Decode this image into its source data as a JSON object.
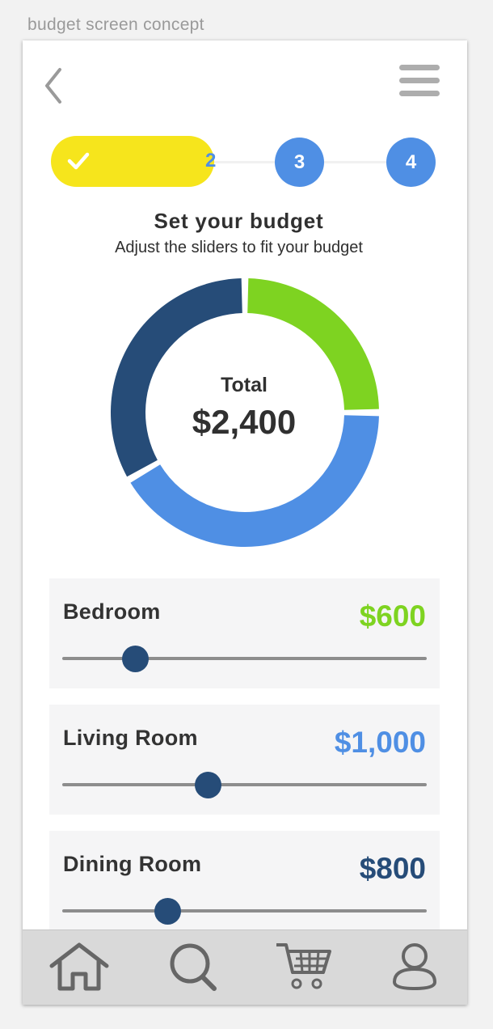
{
  "caption": "budget screen concept",
  "header": {
    "back_icon": "chevron-left-icon",
    "menu_icon": "hamburger-menu-icon"
  },
  "stepper": {
    "completed_icon": "check-icon",
    "current_step": "2",
    "steps": [
      "3",
      "4"
    ]
  },
  "page": {
    "title": "Set your budget",
    "subtitle": "Adjust the sliders to fit your budget"
  },
  "summary": {
    "total_label": "Total",
    "total_value": "$2,400"
  },
  "categories": [
    {
      "name": "Bedroom",
      "amount": "$600",
      "value": 600,
      "color": "#7ed321",
      "slider_fraction": 0.2
    },
    {
      "name": "Living Room",
      "amount": "$1,000",
      "value": 1000,
      "color": "#4f8fe4",
      "slider_fraction": 0.4
    },
    {
      "name": "Dining Room",
      "amount": "$800",
      "value": 800,
      "color": "#264c78",
      "slider_fraction": 0.29
    }
  ],
  "bottom_nav": {
    "items": [
      "home-icon",
      "search-icon",
      "cart-icon",
      "profile-icon"
    ]
  },
  "colors": {
    "accent_yellow": "#f6e51c",
    "accent_blue": "#4f8fe4",
    "accent_green": "#7ed321",
    "accent_navy": "#264c78"
  }
}
